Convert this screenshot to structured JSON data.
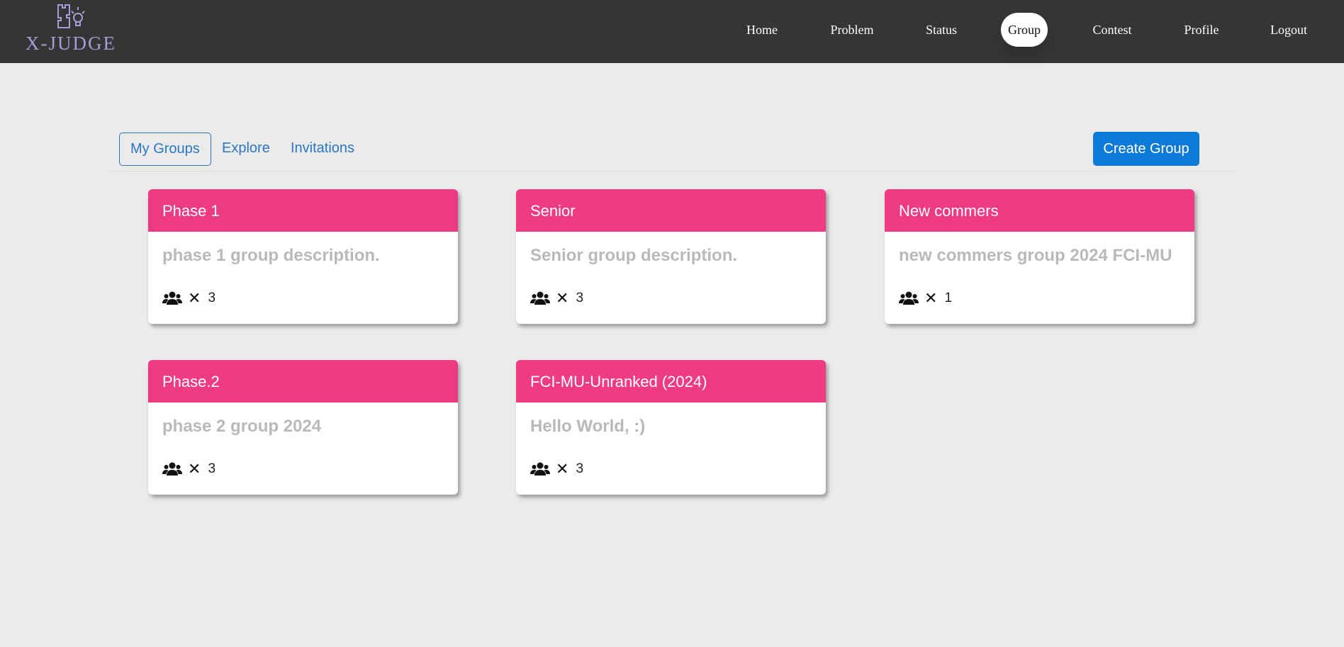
{
  "app": {
    "logo_text": "X-JUDGE"
  },
  "nav": {
    "items": [
      {
        "label": "Home"
      },
      {
        "label": "Problem"
      },
      {
        "label": "Status"
      },
      {
        "label": "Group",
        "active": true
      },
      {
        "label": "Contest"
      },
      {
        "label": "Profile"
      },
      {
        "label": "Logout"
      }
    ]
  },
  "tabs": {
    "items": [
      {
        "label": "My Groups",
        "active": true
      },
      {
        "label": "Explore"
      },
      {
        "label": "Invitations"
      }
    ],
    "create_label": "Create Group"
  },
  "groups": [
    {
      "name": "Phase 1",
      "description": "phase 1 group description.",
      "times_symbol": "✕",
      "members": "3",
      "icon": "users-icon"
    },
    {
      "name": "Senior",
      "description": "Senior group description.",
      "times_symbol": "✕",
      "members": "3",
      "icon": "users-icon"
    },
    {
      "name": "New commers",
      "description": "new commers group 2024 FCI-MU",
      "times_symbol": "✕",
      "members": "1",
      "icon": "users-icon"
    },
    {
      "name": "Phase.2",
      "description": "phase 2 group 2024",
      "times_symbol": "✕",
      "members": "3",
      "icon": "users-icon"
    },
    {
      "name": "FCI-MU-Unranked (2024)",
      "description": "Hello World, :)",
      "times_symbol": "✕",
      "members": "3",
      "icon": "users-icon"
    }
  ],
  "colors": {
    "navbar": "#353535",
    "page_bg": "#ebebeb",
    "card_header": "#ee3b84",
    "link": "#2b77c4",
    "primary_button": "#0e7ad8",
    "logo": "#a89bd6"
  }
}
